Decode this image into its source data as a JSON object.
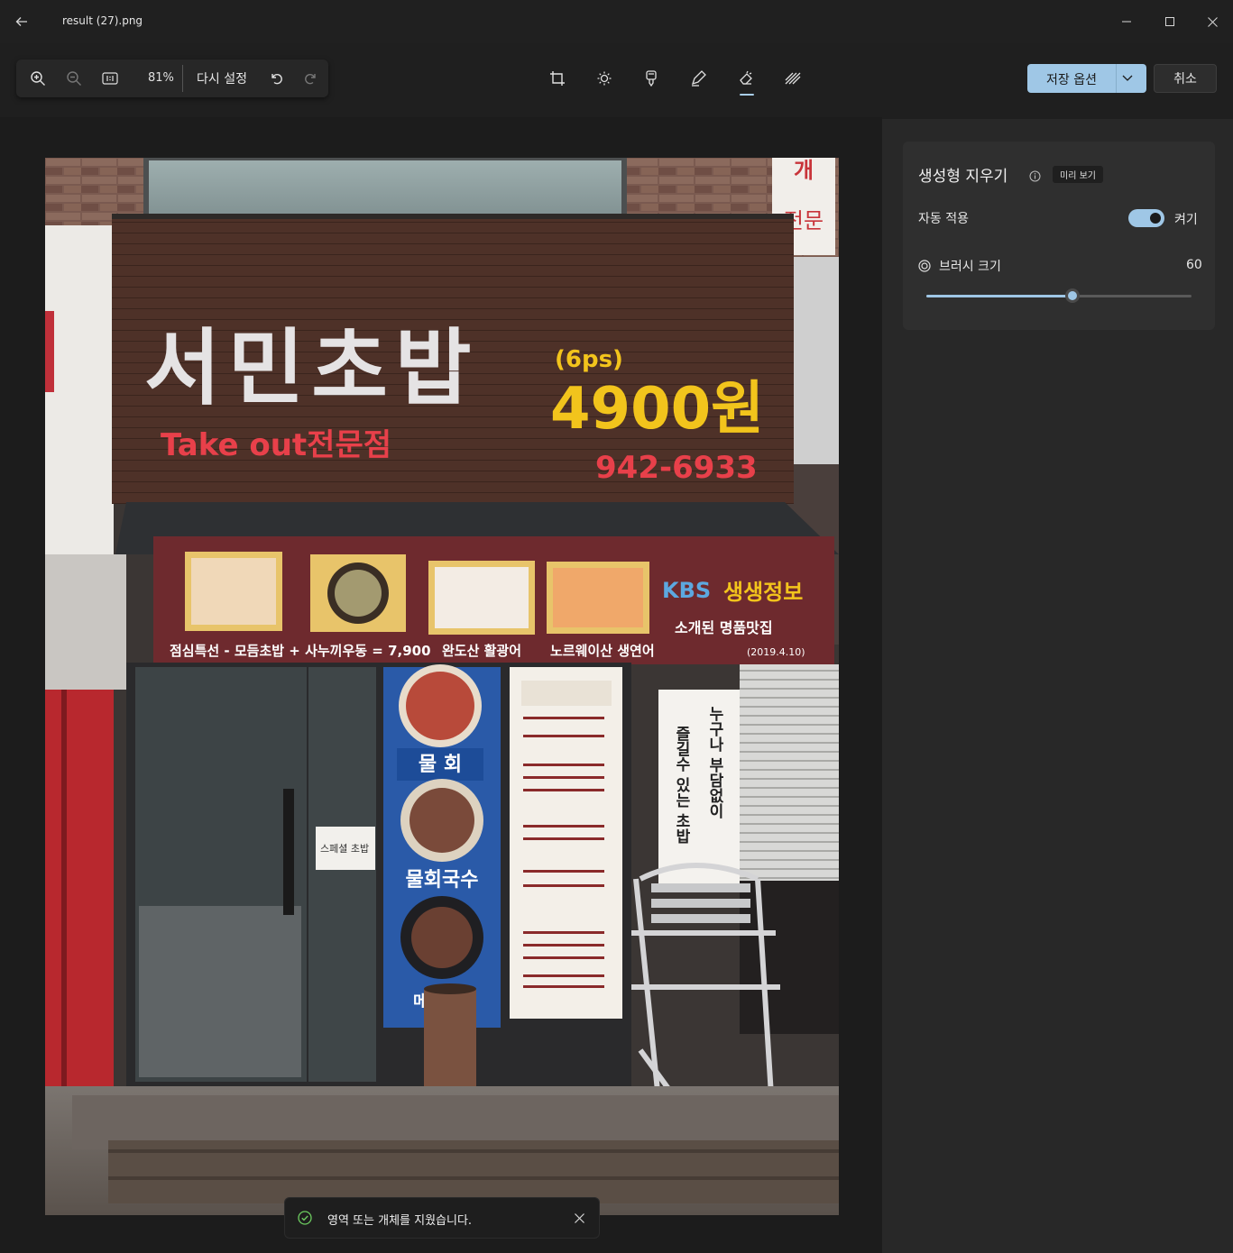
{
  "window": {
    "title": "result (27).png"
  },
  "zoombar": {
    "zoom": "81%",
    "reset_label": "다시 설정"
  },
  "header": {
    "save_label": "저장 옵션",
    "cancel_label": "취소"
  },
  "panel": {
    "title": "생성형 지우기",
    "preview_badge": "미리 보기",
    "auto_apply_label": "자동 적용",
    "auto_apply_state": "켜기",
    "auto_apply_on": true,
    "brush_label": "브러시 크기",
    "brush_value": "60",
    "brush_fraction": 0.55
  },
  "toast": {
    "message": "영역 또는 개체를 지웠습니다."
  },
  "photo": {
    "sign_name": "서민초밥",
    "sign_pieces": "(6ps)",
    "sign_price": "4900원",
    "sign_takeout": "Take out전문점",
    "sign_phone": "942-6933",
    "banner_text": "점심특선 - 모듬초밥 + 사누끼우동 = 7,900",
    "banner_item2": "완도산 활광어",
    "banner_item3": "노르웨이산 생연어",
    "banner_kbs": "KBS",
    "banner_show": "생생정보",
    "banner_intro": "소개된 명품맛집",
    "banner_date": "(2019.4.10)",
    "poster_1": "물 회",
    "poster_2": "물회국수",
    "poster_3": "메",
    "side_sign_1": "누구나 부담없이",
    "side_sign_2": "즐길수 있는 초밥",
    "corner_sign": "전문",
    "door_note": "스페셜 초밥"
  },
  "colors": {
    "accent": "#9fc7e6",
    "sign_board": "#4e3128",
    "banner": "#6e2a2e",
    "price_yellow": "#f2c41c",
    "sign_red": "#e8404a"
  }
}
